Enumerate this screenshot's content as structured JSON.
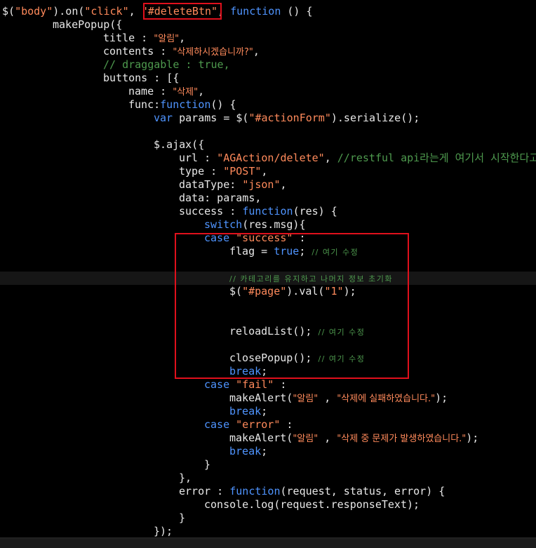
{
  "colors": {
    "background": "#000000",
    "plain": "#e8e8e8",
    "string": "#ff8a5b",
    "keyword": "#4f94ff",
    "comment": "#4e9a4e",
    "annotation_box": "#e0101c"
  },
  "code_lines": [
    {
      "indent": 0,
      "tokens": [
        [
          "$(",
          "p"
        ],
        [
          "\"body\"",
          "s"
        ],
        ").on(",
        [
          "\"click\"",
          "s"
        ],
        ", ",
        [
          "\"#deleteBtn\"",
          "s"
        ],
        ", ",
        [
          "function",
          "k"
        ],
        " () {"
      ]
    },
    {
      "indent": 8,
      "tokens": [
        "makePopup({"
      ]
    },
    {
      "indent": 16,
      "tokens": [
        "title : ",
        [
          "\"알림\"",
          "sk"
        ],
        ","
      ]
    },
    {
      "indent": 16,
      "tokens": [
        "contents : ",
        [
          "\"삭제하시겠습니까?\"",
          "sk"
        ],
        ","
      ]
    },
    {
      "indent": 16,
      "tokens": [
        [
          "// draggable : true,",
          "c"
        ]
      ]
    },
    {
      "indent": 16,
      "tokens": [
        "buttons : [{"
      ]
    },
    {
      "indent": 20,
      "tokens": [
        "name : ",
        [
          "\"삭제\"",
          "sk"
        ],
        ","
      ]
    },
    {
      "indent": 20,
      "tokens": [
        "func:",
        [
          "function",
          "k"
        ],
        "() {"
      ]
    },
    {
      "indent": 24,
      "tokens": [
        [
          "var",
          "k"
        ],
        " params = $(",
        [
          "\"#actionForm\"",
          "s"
        ],
        ").serialize();"
      ]
    },
    {
      "indent": 0,
      "tokens": []
    },
    {
      "indent": 24,
      "tokens": [
        "$.ajax({"
      ]
    },
    {
      "indent": 28,
      "tokens": [
        "url : ",
        [
          "\"AGAction/delete\"",
          "s"
        ],
        ", ",
        [
          "//restful api라는게 여기서 시작한다고?",
          "c"
        ]
      ]
    },
    {
      "indent": 28,
      "tokens": [
        "type : ",
        [
          "\"POST\"",
          "s"
        ],
        ","
      ]
    },
    {
      "indent": 28,
      "tokens": [
        "dataType: ",
        [
          "\"json\"",
          "s"
        ],
        ","
      ]
    },
    {
      "indent": 28,
      "tokens": [
        "data: params,"
      ]
    },
    {
      "indent": 28,
      "tokens": [
        "success : ",
        [
          "function",
          "k"
        ],
        "(res) {"
      ]
    },
    {
      "indent": 32,
      "tokens": [
        [
          "switch",
          "k"
        ],
        "(res.msg){"
      ]
    },
    {
      "indent": 32,
      "tokens": [
        [
          "case",
          "k"
        ],
        " ",
        [
          "\"success\"",
          "s"
        ],
        " :"
      ]
    },
    {
      "indent": 36,
      "tokens": [
        "flag = ",
        [
          "true",
          "k"
        ],
        "; ",
        [
          "// 여기 수정",
          "ck"
        ]
      ]
    },
    {
      "indent": 0,
      "tokens": []
    },
    {
      "indent": 36,
      "tokens": [
        [
          "// 카테고리를 유지하고 나머지 정보 초기화",
          "ck"
        ]
      ],
      "highlight": true
    },
    {
      "indent": 36,
      "tokens": [
        "$(",
        [
          "\"#page\"",
          "s"
        ],
        ").val(",
        [
          "\"1\"",
          "s"
        ],
        ");"
      ]
    },
    {
      "indent": 0,
      "tokens": []
    },
    {
      "indent": 0,
      "tokens": []
    },
    {
      "indent": 36,
      "tokens": [
        "reloadList(); ",
        [
          "// 여기 수정",
          "ck"
        ]
      ]
    },
    {
      "indent": 0,
      "tokens": []
    },
    {
      "indent": 36,
      "tokens": [
        "closePopup(); ",
        [
          "// 여기 수정",
          "ck"
        ]
      ]
    },
    {
      "indent": 36,
      "tokens": [
        [
          "break",
          "k"
        ],
        ";"
      ]
    },
    {
      "indent": 32,
      "tokens": [
        [
          "case",
          "k"
        ],
        " ",
        [
          "\"fail\"",
          "s"
        ],
        " :"
      ]
    },
    {
      "indent": 36,
      "tokens": [
        "makeAlert(",
        [
          "\"알림\"",
          "sk"
        ],
        " , ",
        [
          "\"삭제에 실패하였습니다.\"",
          "sk"
        ],
        ");"
      ]
    },
    {
      "indent": 36,
      "tokens": [
        [
          "break",
          "k"
        ],
        ";"
      ]
    },
    {
      "indent": 32,
      "tokens": [
        [
          "case",
          "k"
        ],
        " ",
        [
          "\"error\"",
          "s"
        ],
        " :"
      ]
    },
    {
      "indent": 36,
      "tokens": [
        "makeAlert(",
        [
          "\"알림\"",
          "sk"
        ],
        " , ",
        [
          "\"삭제 중 문제가 발생하였습니다.\"",
          "sk"
        ],
        ");"
      ]
    },
    {
      "indent": 36,
      "tokens": [
        [
          "break",
          "k"
        ],
        ";"
      ]
    },
    {
      "indent": 32,
      "tokens": [
        "}"
      ]
    },
    {
      "indent": 28,
      "tokens": [
        "},"
      ]
    },
    {
      "indent": 28,
      "tokens": [
        "error : ",
        [
          "function",
          "k"
        ],
        "(request, status, error) {"
      ]
    },
    {
      "indent": 32,
      "tokens": [
        "console.log(request.responseText);"
      ]
    },
    {
      "indent": 28,
      "tokens": [
        "}"
      ]
    },
    {
      "indent": 24,
      "tokens": [
        "});"
      ]
    }
  ]
}
